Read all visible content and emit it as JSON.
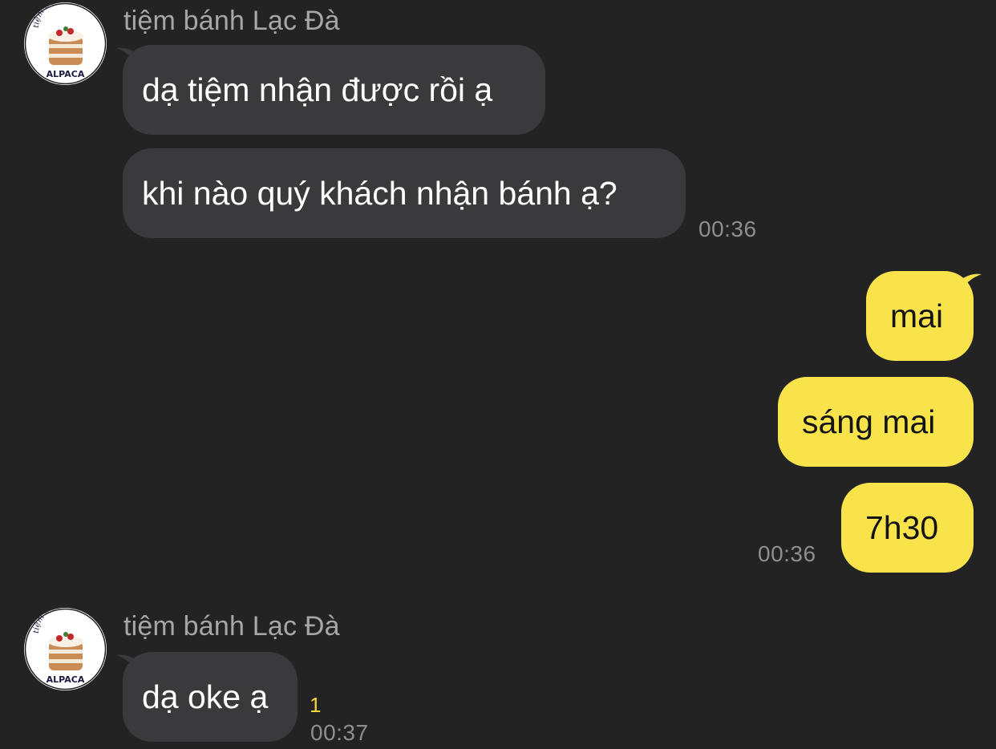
{
  "colors": {
    "background": "#232324",
    "incoming_bubble": "#3a3a3c",
    "outgoing_bubble": "#f9e34b",
    "timestamp": "#8e8e90",
    "unread": "#f4d63c"
  },
  "avatar": {
    "arc_text": "tiệm bánh kem",
    "brand_text": "ALPACA",
    "icon": "cake-logo-icon"
  },
  "groups": [
    {
      "sender": "tiệm bánh Lạc Đà",
      "messages": [
        "dạ tiệm nhận được rồi ạ",
        "khi nào quý khách nhận bánh ạ?"
      ],
      "time": "00:36"
    },
    {
      "sender": "",
      "messages": [
        "mai",
        "sáng mai",
        "7h30"
      ],
      "time": "00:36"
    },
    {
      "sender": "tiệm bánh Lạc Đà",
      "messages": [
        "dạ oke ạ"
      ],
      "unread_count": "1",
      "time": "00:37"
    }
  ]
}
